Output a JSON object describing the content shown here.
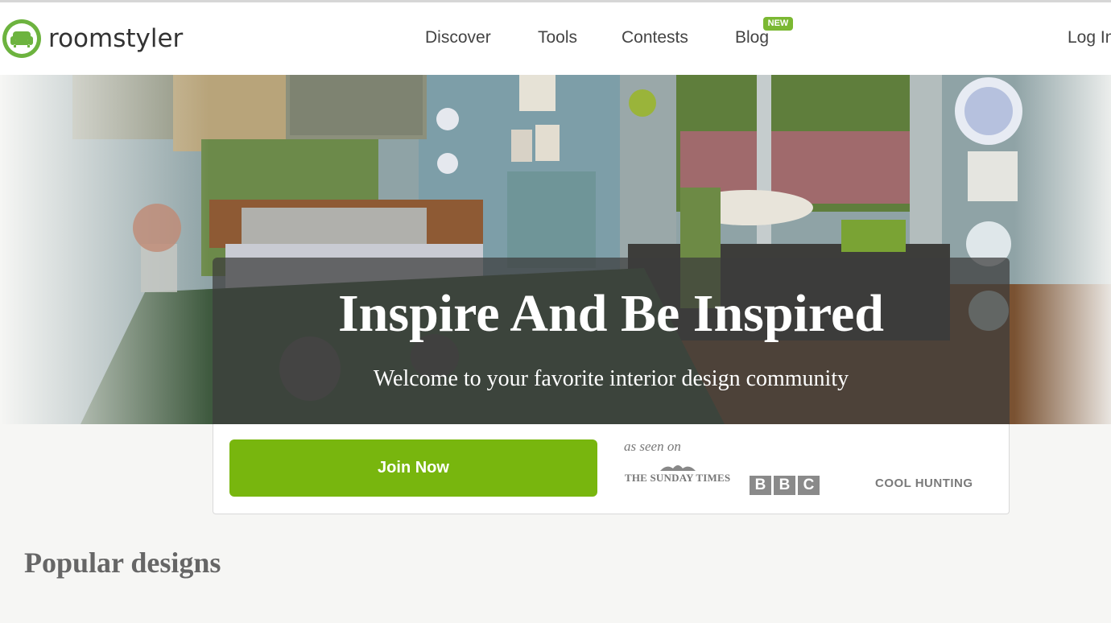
{
  "brand": {
    "name": "roomstyler",
    "logo_icon": "armchair-logo-icon",
    "accent_color": "#6db33f"
  },
  "nav": {
    "items": [
      {
        "label": "Discover"
      },
      {
        "label": "Tools"
      },
      {
        "label": "Contests"
      },
      {
        "label": "Blog",
        "badge": "NEW"
      }
    ],
    "login_label": "Log In"
  },
  "hero": {
    "title": "Inspire And Be Inspired",
    "subtitle": "Welcome to your favorite interior design community"
  },
  "join": {
    "button_label": "Join Now",
    "button_color": "#78b60e",
    "seen_on_label": "as seen on",
    "press": {
      "times": "THE SUNDAY TIMES",
      "bbc": [
        "B",
        "B",
        "C"
      ],
      "cool": "COOL HUNTING"
    }
  },
  "popular": {
    "title": "Popular designs"
  }
}
